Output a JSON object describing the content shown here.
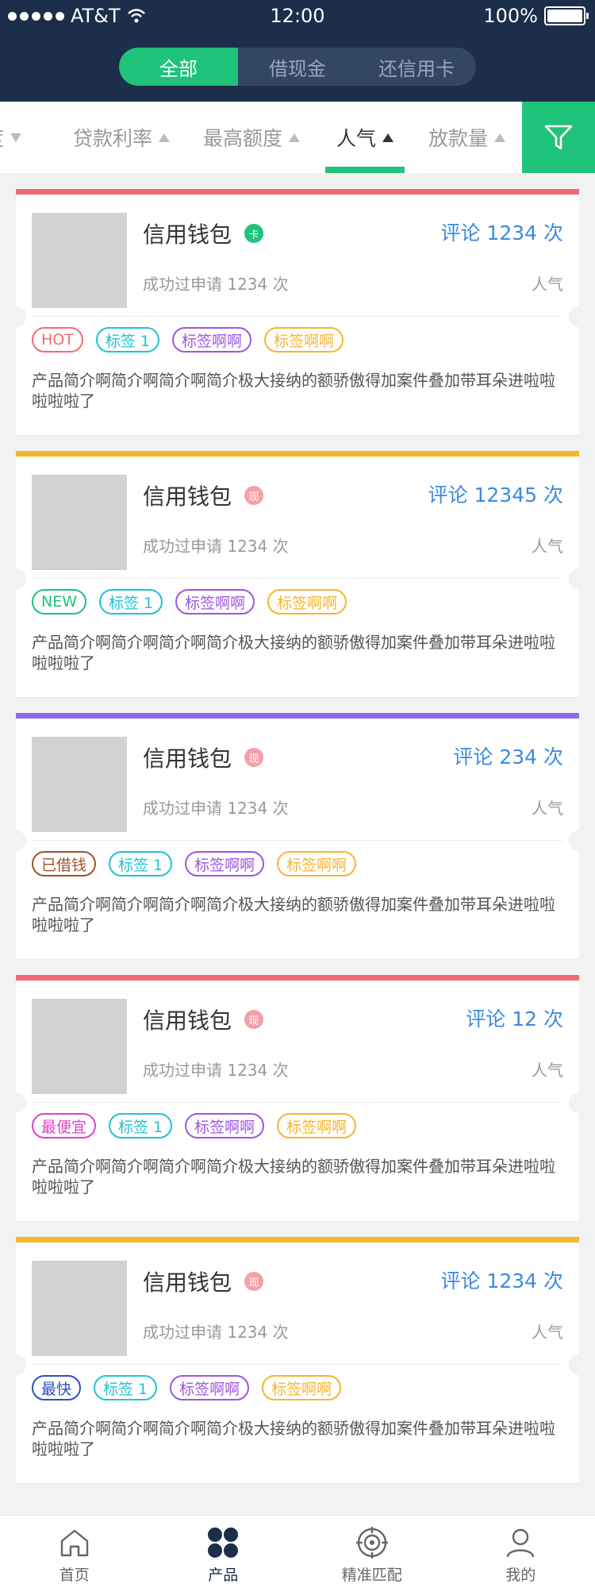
{
  "status": {
    "carrier": "AT&T",
    "time": "12:00",
    "battery": "100%"
  },
  "segments": [
    "全部",
    "借现金",
    "还信用卡"
  ],
  "sort_options": [
    "度",
    "贷款利率",
    "最高额度",
    "人气",
    "放款量"
  ],
  "colors": {
    "accent": "#1fc37a",
    "nav_bg": "#1c2e4a",
    "link": "#3a8be0"
  },
  "products": [
    {
      "name": "信用钱包",
      "badge": "卡",
      "badge_color": "green",
      "comments": "评论 1234 次",
      "applied": "成功过申请 1234 次",
      "pop_label": "人气",
      "bar_color": "#f26b73",
      "tags": [
        {
          "label": "HOT",
          "color": "#f26b73"
        },
        {
          "label": "标签 1",
          "color": "#1fc3d2"
        },
        {
          "label": "标签啊啊",
          "color": "#9f55e0"
        },
        {
          "label": "标签啊啊",
          "color": "#f7b52e"
        }
      ],
      "desc": "产品简介啊简介啊简介啊简介极大接纳的额骄傲得加案件叠加带耳朵进啦啦啦啦啦了"
    },
    {
      "name": "信用钱包",
      "badge": "现",
      "badge_color": "pink",
      "comments": "评论 12345 次",
      "applied": "成功过申请 1234 次",
      "pop_label": "人气",
      "bar_color": "#f7b52e",
      "tags": [
        {
          "label": "NEW",
          "color": "#1fc37a"
        },
        {
          "label": "标签 1",
          "color": "#1fc3d2"
        },
        {
          "label": "标签啊啊",
          "color": "#9f55e0"
        },
        {
          "label": "标签啊啊",
          "color": "#f7b52e"
        }
      ],
      "desc": "产品简介啊简介啊简介啊简介极大接纳的额骄傲得加案件叠加带耳朵进啦啦啦啦啦了"
    },
    {
      "name": "信用钱包",
      "badge": "现",
      "badge_color": "pink",
      "comments": "评论 234 次",
      "applied": "成功过申请 1234 次",
      "pop_label": "人气",
      "bar_color": "#8a6be8",
      "tags": [
        {
          "label": "已借钱",
          "color": "#a0522d"
        },
        {
          "label": "标签 1",
          "color": "#1fc3d2"
        },
        {
          "label": "标签啊啊",
          "color": "#9f55e0"
        },
        {
          "label": "标签啊啊",
          "color": "#f7b52e"
        }
      ],
      "desc": "产品简介啊简介啊简介啊简介极大接纳的额骄傲得加案件叠加带耳朵进啦啦啦啦啦了"
    },
    {
      "name": "信用钱包",
      "badge": "现",
      "badge_color": "pink",
      "comments": "评论 12 次",
      "applied": "成功过申请 1234 次",
      "pop_label": "人气",
      "bar_color": "#f26b73",
      "tags": [
        {
          "label": "最便宜",
          "color": "#e040c8"
        },
        {
          "label": "标签 1",
          "color": "#1fc3d2"
        },
        {
          "label": "标签啊啊",
          "color": "#9f55e0"
        },
        {
          "label": "标签啊啊",
          "color": "#f7b52e"
        }
      ],
      "desc": "产品简介啊简介啊简介啊简介极大接纳的额骄傲得加案件叠加带耳朵进啦啦啦啦啦了"
    },
    {
      "name": "信用钱包",
      "badge": "现",
      "badge_color": "pink",
      "comments": "评论 1234 次",
      "applied": "成功过申请 1234 次",
      "pop_label": "人气",
      "bar_color": "#f7b52e",
      "tags": [
        {
          "label": "最快",
          "color": "#2b4fc4"
        },
        {
          "label": "标签 1",
          "color": "#1fc3d2"
        },
        {
          "label": "标签啊啊",
          "color": "#9f55e0"
        },
        {
          "label": "标签啊啊",
          "color": "#f7b52e"
        }
      ],
      "desc": "产品简介啊简介啊简介啊简介极大接纳的额骄傲得加案件叠加带耳朵进啦啦啦啦啦了"
    }
  ],
  "tabs": [
    {
      "label": "首页",
      "icon": "home-icon"
    },
    {
      "label": "产品",
      "icon": "grid-icon"
    },
    {
      "label": "精准匹配",
      "icon": "target-icon"
    },
    {
      "label": "我的",
      "icon": "user-icon"
    }
  ]
}
